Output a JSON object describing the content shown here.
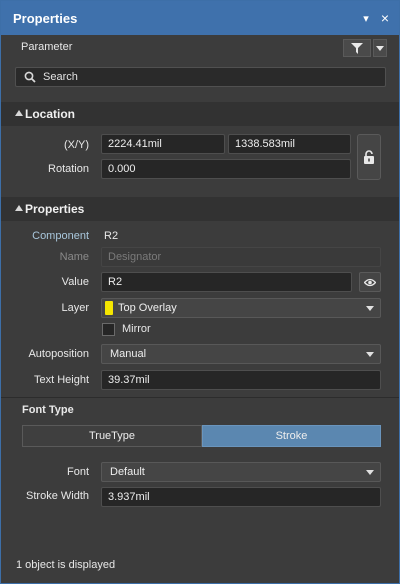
{
  "panel": {
    "title": "Properties",
    "pin_glyph": "▾",
    "close_glyph": "×"
  },
  "filter": {
    "label": "Parameter"
  },
  "search": {
    "placeholder": "Search"
  },
  "location": {
    "header": "Location",
    "xy_label": "(X/Y)",
    "x_value": "2224.41mil",
    "y_value": "1338.583mil",
    "rotation_label": "Rotation",
    "rotation_value": "0.000"
  },
  "properties": {
    "header": "Properties",
    "component_label": "Component",
    "component_value": "R2",
    "name_label": "Name",
    "name_value": "Designator",
    "value_label": "Value",
    "value_value": "R2",
    "layer_label": "Layer",
    "layer_value": "Top Overlay",
    "layer_color": "#f5e600",
    "mirror_label": "Mirror",
    "mirror_checked": false,
    "autoposition_label": "Autoposition",
    "autoposition_value": "Manual",
    "text_height_label": "Text Height",
    "text_height_value": "39.37mil"
  },
  "font_type": {
    "header": "Font Type",
    "options": [
      "TrueType",
      "Stroke"
    ],
    "selected": "Stroke",
    "font_label": "Font",
    "font_value": "Default",
    "stroke_width_label": "Stroke Width",
    "stroke_width_value": "3.937mil"
  },
  "status": {
    "text": "1 object is displayed"
  },
  "colors": {
    "title_bar": "#3f71ac",
    "accent_selected": "#5b87b0"
  },
  "icons": [
    "filter-icon",
    "search-icon",
    "lock-icon",
    "eye-icon"
  ]
}
